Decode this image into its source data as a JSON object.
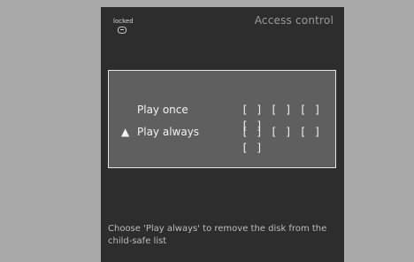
{
  "header": {
    "status_text": "locked",
    "title": "Access control"
  },
  "options": [
    {
      "selected_marker": "",
      "label": "Play once",
      "code": "[ ] [ ] [ ] [ ]"
    },
    {
      "selected_marker": "▲",
      "label": "Play always",
      "code": "[ ] [ ] [ ] [ ]"
    }
  ],
  "footer": {
    "hint_text": "Choose 'Play always' to remove the disk from the child-safe list"
  },
  "colors": {
    "background": "#a9a9a9",
    "screen": "#2d2d2d",
    "panel": "#5f5f5f",
    "panel_border": "#e6e6e6",
    "text": "#f2f2f2",
    "muted_text": "#bdbdbd"
  }
}
